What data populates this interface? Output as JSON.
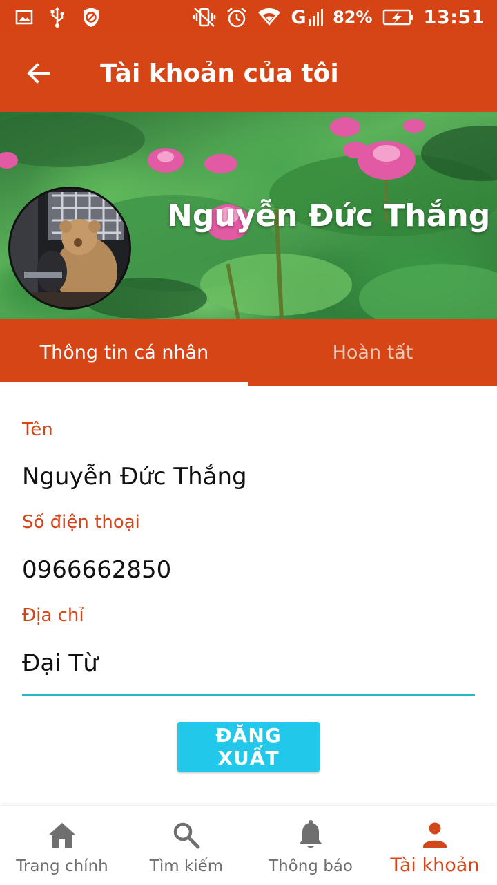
{
  "status_bar": {
    "network": "G",
    "battery": "82%",
    "time": "13:51"
  },
  "app_bar": {
    "title": "Tài khoản của tôi"
  },
  "profile": {
    "name": "Nguyễn Đức Thắng"
  },
  "tabs": [
    {
      "label": "Thông tin cá nhân",
      "active": true
    },
    {
      "label": "Hoàn tất",
      "active": false
    }
  ],
  "form": {
    "name_label": "Tên",
    "name_value": "Nguyễn Đức Thắng",
    "phone_label": "Số điện thoại",
    "phone_value": "0966662850",
    "address_label": "Địa chỉ",
    "address_value": "Đại Từ"
  },
  "logout_label": "ĐĂNG XUẤT",
  "bottom_nav": [
    {
      "label": "Trang chính",
      "icon": "home-icon",
      "active": false
    },
    {
      "label": "Tìm kiếm",
      "icon": "search-icon",
      "active": false
    },
    {
      "label": "Thông báo",
      "icon": "bell-icon",
      "active": false
    },
    {
      "label": "Tài khoản",
      "icon": "person-icon",
      "active": true
    }
  ],
  "colors": {
    "primary": "#d64516",
    "status_bar": "#d64314",
    "label": "#d2461b",
    "accent": "#22c8ea",
    "underline": "#28b7c9"
  }
}
